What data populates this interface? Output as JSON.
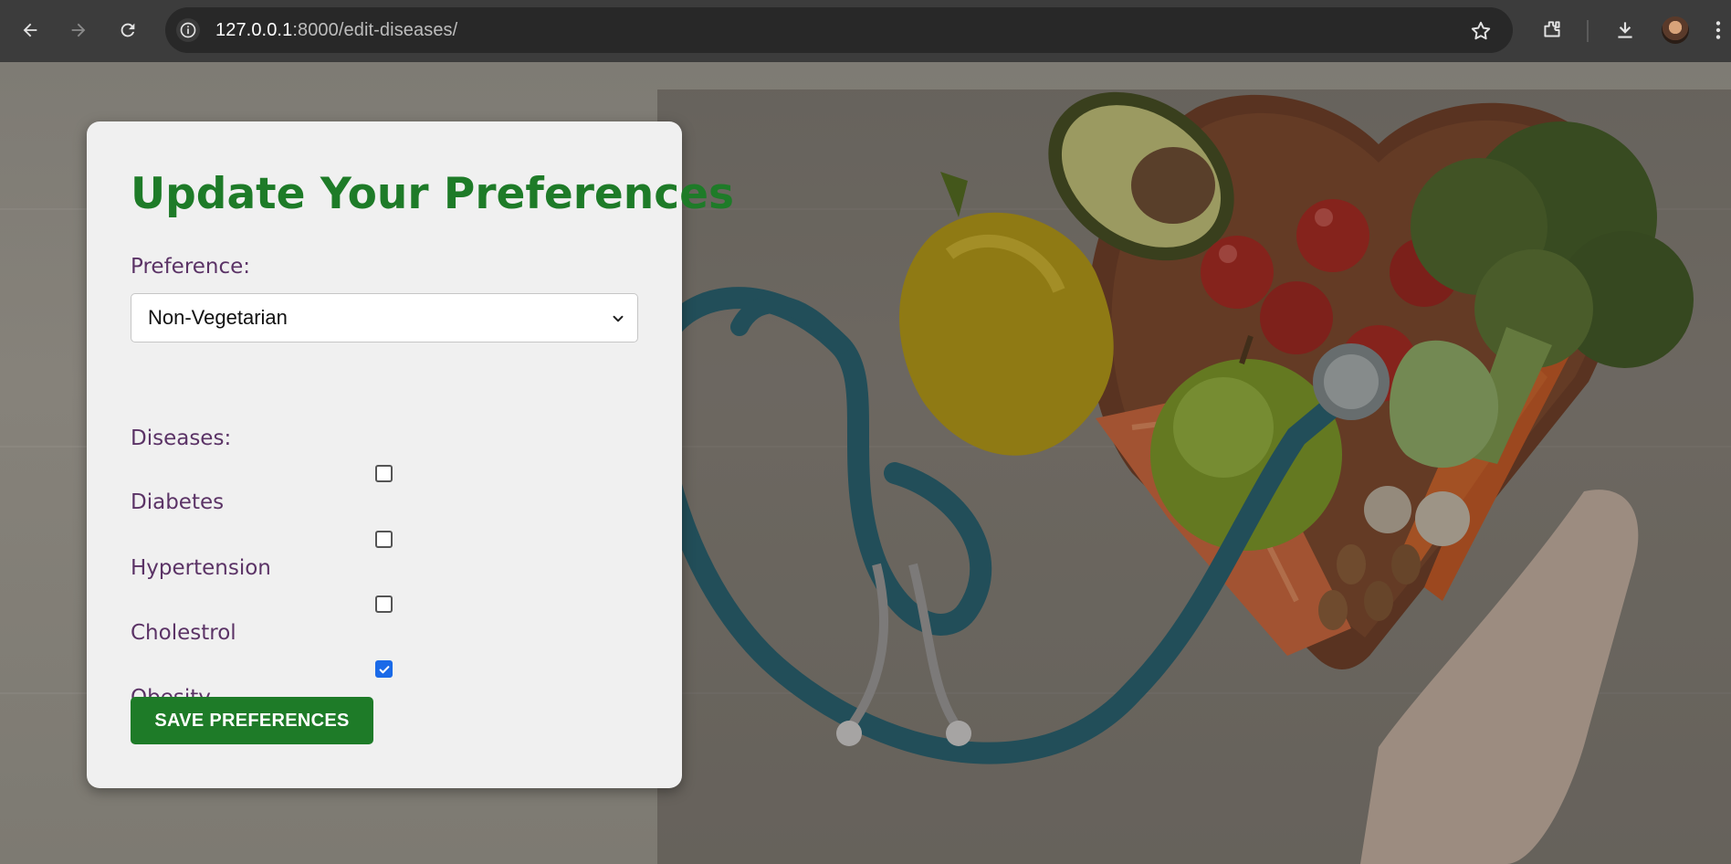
{
  "browser": {
    "url_host": "127.0.0.1",
    "url_path": ":8000/edit-diseases/"
  },
  "form": {
    "title": "Update Your Preferences",
    "preference_label": "Preference:",
    "preference_value": "Non-Vegetarian",
    "diseases_label": "Diseases:",
    "diseases": [
      {
        "label": "Diabetes",
        "checked": false
      },
      {
        "label": "Hypertension",
        "checked": false
      },
      {
        "label": "Cholestrol",
        "checked": false
      },
      {
        "label": "Obesity",
        "checked": true
      }
    ],
    "save_label": "SAVE PREFERENCES"
  },
  "colors": {
    "accent_green": "#1e7b28",
    "label_purple": "#5b3366",
    "checkbox_blue": "#1a6ae8"
  },
  "icons": [
    "back-arrow-icon",
    "forward-arrow-icon",
    "reload-icon",
    "site-info-icon",
    "bookmark-star-icon",
    "extensions-icon",
    "download-icon",
    "profile-avatar",
    "more-menu-icon",
    "chevron-down-icon",
    "checkmark-icon"
  ]
}
